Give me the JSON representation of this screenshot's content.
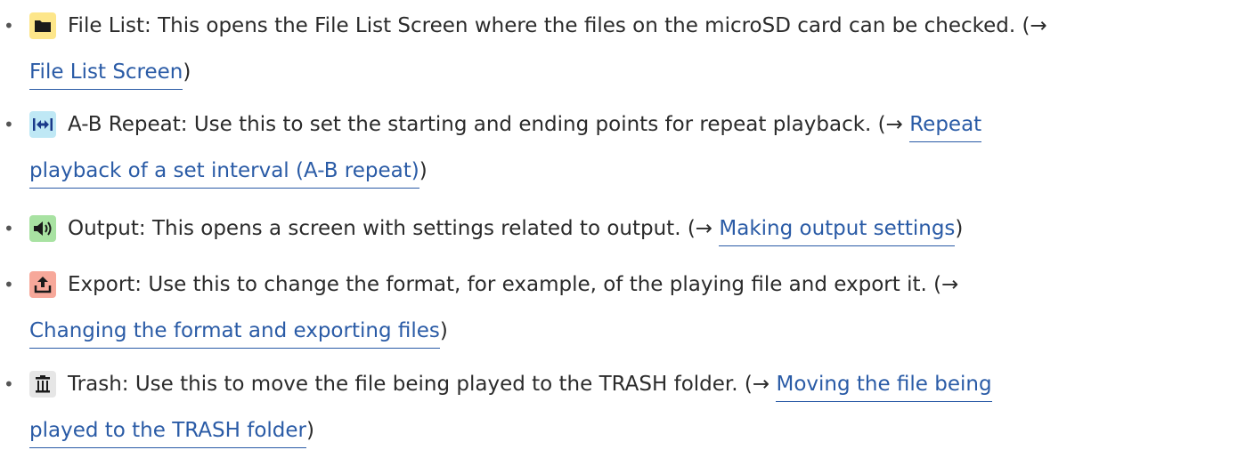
{
  "bullet_char": "•",
  "colors": {
    "link": "#2a5ba6",
    "text": "#2b2b2b",
    "file_list_icon_bg": "#fde68a",
    "ab_repeat_icon_bg": "#bfe8f5",
    "output_icon_bg": "#a8e2a2",
    "export_icon_bg": "#f7a89a",
    "trash_icon_bg": "#e6e6e6"
  },
  "items": [
    {
      "icon": "folder-icon",
      "text": "File List: This opens the File List Screen where the files on the microSD card can be checked. (→",
      "link_line1": "",
      "link_line2": "File List Screen",
      "close": ")"
    },
    {
      "icon": "ab-repeat-icon",
      "text": "A-B Repeat: Use this to set the starting and ending points for repeat playback. (→ ",
      "link_line1": "Repeat",
      "link_line2": "playback of a set interval (A-B repeat)",
      "close": ")"
    },
    {
      "icon": "speaker-icon",
      "text": "Output: This opens a screen with settings related to output. (→ ",
      "link_line1": "Making output settings",
      "link_line2": "",
      "close": ")"
    },
    {
      "icon": "export-icon",
      "text": "Export: Use this to change the format, for example, of the playing file and export it. (→",
      "link_line1": "",
      "link_line2": "Changing the format and exporting files",
      "close": ")"
    },
    {
      "icon": "trash-icon",
      "text": "Trash: Use this to move the file being played to the TRASH folder. (→ ",
      "link_line1": "Moving the file being",
      "link_line2": "played to the TRASH folder",
      "close": ")"
    }
  ]
}
